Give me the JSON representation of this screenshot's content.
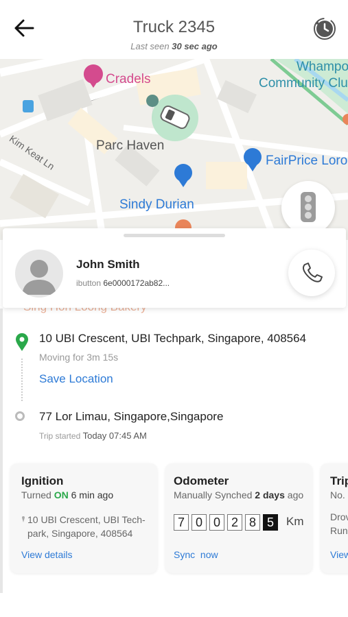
{
  "header": {
    "title": "Truck 2345",
    "subtitle_prefix": "Last seen",
    "subtitle_value": "30 sec ago"
  },
  "map": {
    "labels": {
      "cradels": "Cradels",
      "whampo": "Whampo",
      "community": "Community Clu",
      "kim_keat": "Kim Keat Ln",
      "parc_haven": "Parc Haven",
      "fairprice": "FairPrice Loro",
      "sindy": "Sindy Durian"
    },
    "colors": {
      "poi_pink": "#d44b8e",
      "poi_blue": "#2d7ad6",
      "water": "#a8d8f0",
      "green": "#7ecb93",
      "vehicle_halo": "#bfe6cd"
    }
  },
  "driver": {
    "name": "John Smith",
    "ibutton_label": "ibutton",
    "ibutton_value": "6e0000172ab82..."
  },
  "faded_label": "Sing Hon Loong Bakery",
  "trip": {
    "current_address": "10 UBI Crescent, UBI Techpark, Singapore, 408564",
    "moving_for": "Moving for 3m 15s",
    "save_location": "Save Location",
    "start_address": "77 Lor Limau, Singapore,Singapore",
    "trip_started_label": "Trip started",
    "trip_started_value": "Today 07:45 AM"
  },
  "cards": {
    "ignition": {
      "title": "Ignition",
      "status_prefix": "Turned",
      "status_value": "ON",
      "status_suffix": "6 min ago",
      "location": "10 UBI Crescent, UBI Tech-park, Singapore, 408564",
      "link": "View details"
    },
    "odometer": {
      "title": "Odometer",
      "sync_prefix": "Manually Synched",
      "sync_value": "2 days",
      "sync_suffix": "ago",
      "digits": [
        "7",
        "0",
        "0",
        "2",
        "8",
        "5"
      ],
      "unit": "Km",
      "link": "Sync  now"
    },
    "trip": {
      "title": "Trip",
      "sub": "No. o",
      "line1": "Drov",
      "line2": "Run",
      "link": "View"
    }
  }
}
